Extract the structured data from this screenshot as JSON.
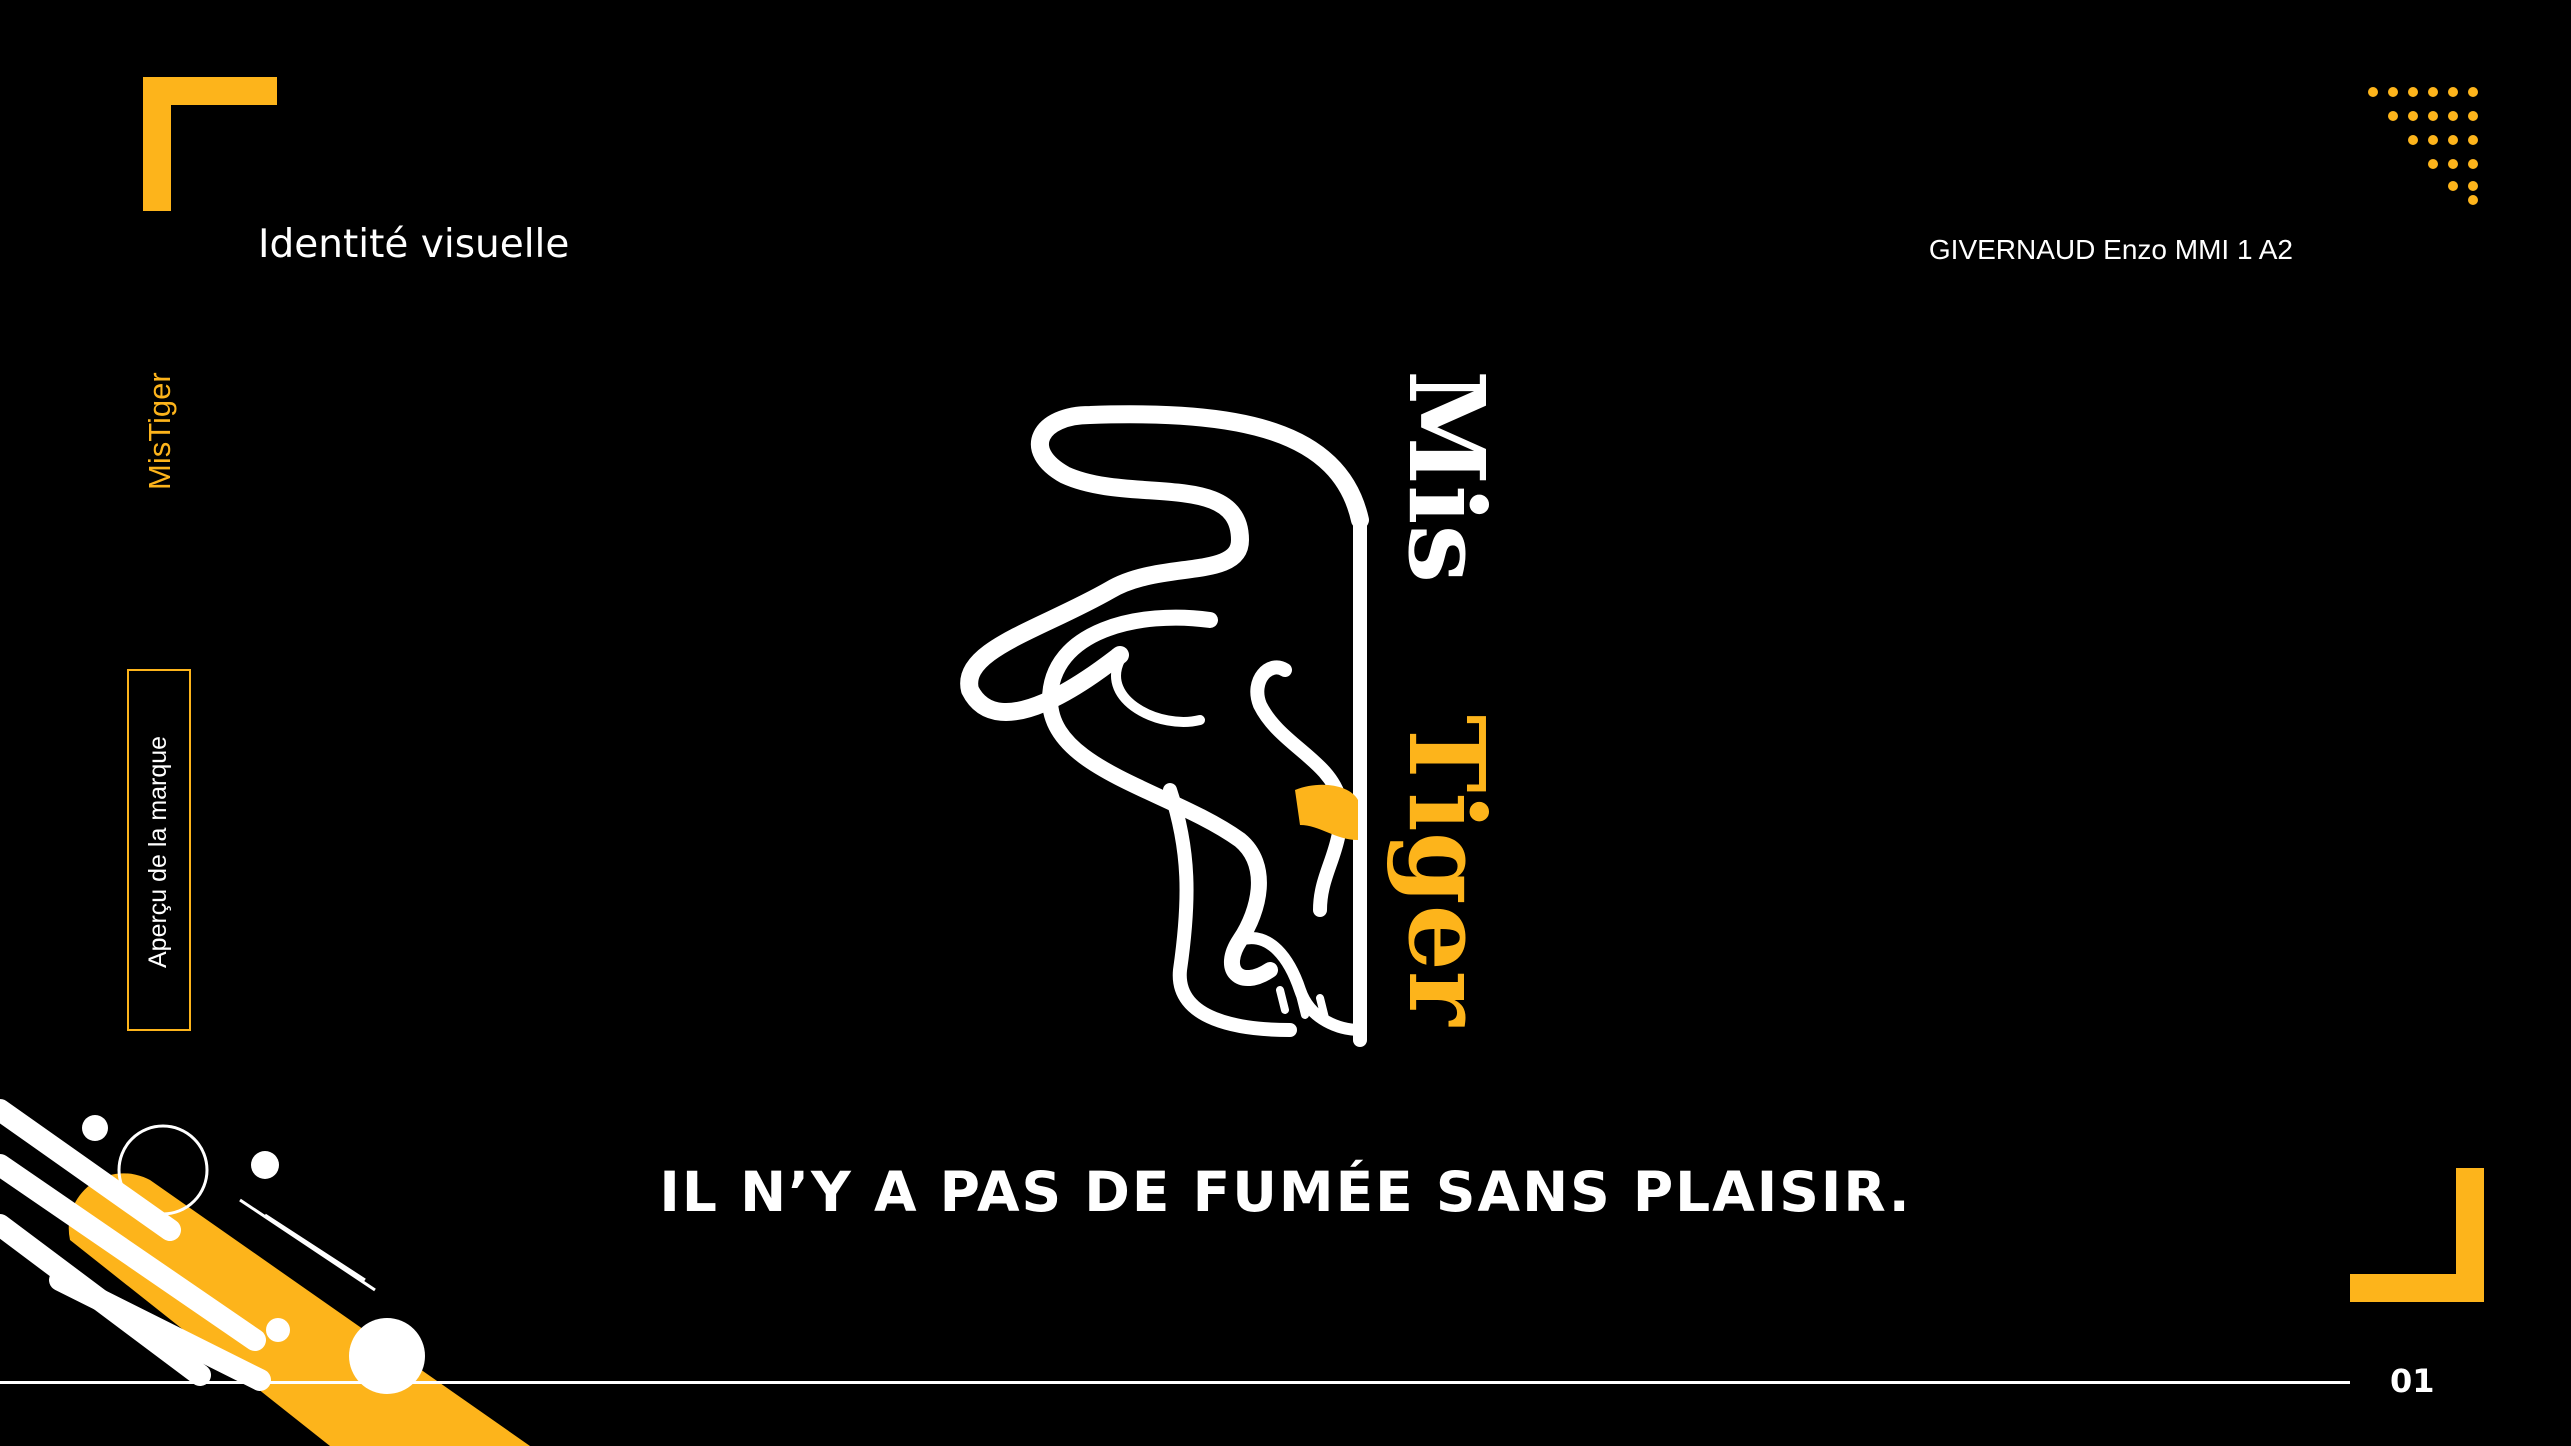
{
  "header": {
    "title": "Identité visuelle",
    "author": "GIVERNAUD Enzo MMI 1 A2"
  },
  "sidebar": {
    "brand": "MisTiger",
    "section": "Aperçu de la marque"
  },
  "logo": {
    "wordmark_prefix": "Mis",
    "wordmark_suffix": "Tiger"
  },
  "slogan": "IL N’Y A PAS DE FUMÉE SANS PLAISIR.",
  "footer": {
    "page_number": "01"
  },
  "colors": {
    "accent": "#fdb41b",
    "background": "#000000",
    "text": "#ffffff"
  }
}
